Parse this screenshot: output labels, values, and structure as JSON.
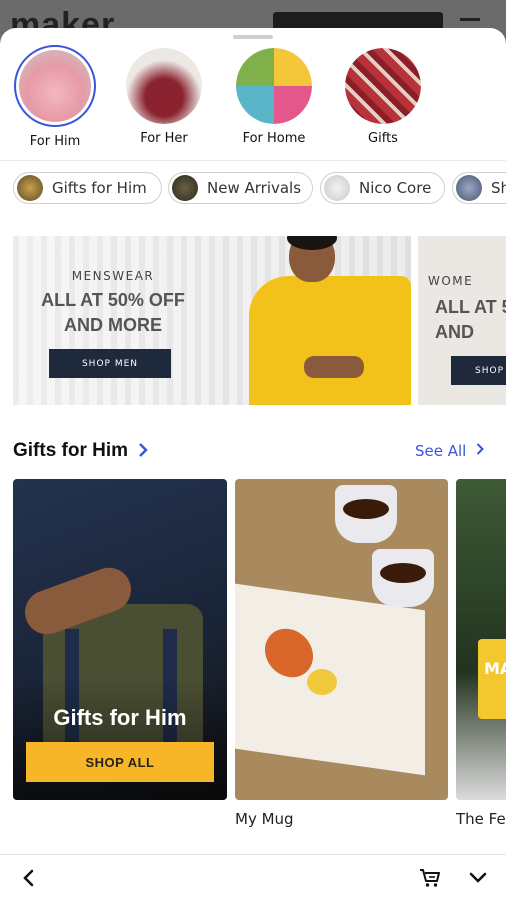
{
  "categories": [
    {
      "label": "For Him",
      "active": true
    },
    {
      "label": "For Her",
      "active": false
    },
    {
      "label": "For Home",
      "active": false
    },
    {
      "label": "Gifts",
      "active": false
    }
  ],
  "chips": [
    {
      "label": "Gifts for Him"
    },
    {
      "label": "New Arrivals"
    },
    {
      "label": "Nico Core"
    },
    {
      "label": "Sh"
    }
  ],
  "banners": [
    {
      "kicker": "MENSWEAR",
      "headline_line1": "ALL AT 50% OFF",
      "headline_line2": "AND MORE",
      "button": "SHOP MEN"
    },
    {
      "kicker": "WOME",
      "headline_line1": "ALL AT 5",
      "headline_line2": "AND",
      "button": "SHOP"
    }
  ],
  "section": {
    "title": "Gifts for Him",
    "see_all": "See All"
  },
  "cards": [
    {
      "overlay_title": "Gifts for Him",
      "button": "SHOP ALL",
      "name": ""
    },
    {
      "name": "My Mug"
    },
    {
      "name": "The Fe",
      "candle_text": "MA"
    }
  ],
  "colors": {
    "accent": "#3b55d9",
    "shop_button": "#f6b628",
    "banner_button": "#1e2a3c",
    "shirt": "#f2c21a"
  },
  "toolbar": {
    "back_icon": "chevron-left-icon",
    "cart_icon": "cart-icon",
    "collapse_icon": "chevron-down-icon"
  }
}
